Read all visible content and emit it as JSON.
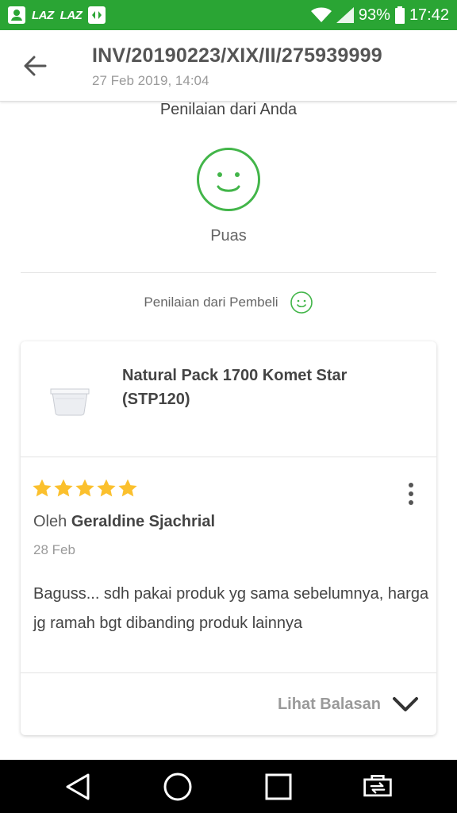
{
  "status_bar": {
    "app_labels": [
      "LAZ",
      "LAZ"
    ],
    "battery": "93%",
    "time": "17:42",
    "icons": [
      "contacts-icon",
      "lazada-icon",
      "lazada-icon",
      "app-icon",
      "wifi-icon",
      "signal-icon",
      "battery-icon"
    ]
  },
  "app_bar": {
    "title": "INV/20190223/XIX/II/275939999",
    "subtitle": "27 Feb 2019, 14:04"
  },
  "my_rating": {
    "title": "Penilaian dari Anda",
    "label": "Puas",
    "icon": "smiley-icon"
  },
  "buyer_rating": {
    "label": "Penilaian dari Pembeli",
    "icon": "smiley-icon"
  },
  "review_card": {
    "product_name": "Natural Pack 1700 Komet Star (STP120)",
    "rating": 5,
    "rating_max": 5,
    "reviewer_prefix": "Oleh",
    "reviewer_name": "Geraldine Sjachrial",
    "date": "28 Feb",
    "text": "Baguss... sdh pakai produk yg sama sebelumnya, harga jg ramah bgt dibanding produk lainnya",
    "see_replies": "Lihat Balasan"
  },
  "colors": {
    "status_bar": "#2aa534",
    "accent_green": "#42b549",
    "star": "#fbc02d"
  },
  "nav_bar": {
    "icons": [
      "back-triangle-icon",
      "home-circle-icon",
      "recents-square-icon",
      "screen-rotate-icon"
    ]
  }
}
